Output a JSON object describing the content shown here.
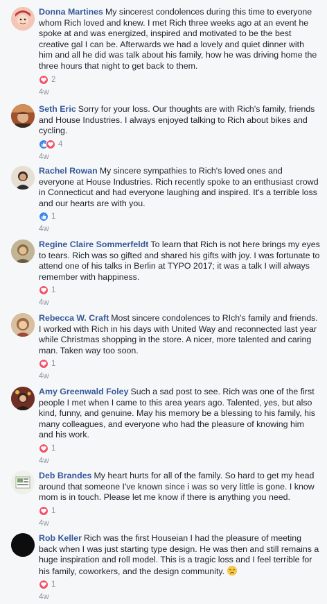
{
  "comments": [
    {
      "author": "Donna Martines",
      "text": "My sincerest condolences during this time to everyone whom Rich loved and knew. I met Rich three weeks ago at an event he spoke at and was energized, inspired and motivated to be the best creative gal I can be. Afterwards we had a lovely and quiet dinner with him and all he did was talk about his family, how he was driving home the three hours that night to get back to them.",
      "reactions": [
        "love"
      ],
      "reaction_count": "2",
      "time": "4w"
    },
    {
      "author": "Seth Eric",
      "text": "Sorry for your loss. Our thoughts are with Rich's family, friends and House Industries. I always enjoyed talking to Rich about bikes and cycling.",
      "reactions": [
        "like",
        "love"
      ],
      "reaction_count": "4",
      "time": "4w"
    },
    {
      "author": "Rachel Rowan",
      "text": "My sincere sympathies to Rich's loved ones and everyone at House Industries. Rich recently spoke to an enthusiast crowd in Connecticut and had everyone laughing and inspired. It's a terrible loss and our hearts are with you.",
      "reactions": [
        "like"
      ],
      "reaction_count": "1",
      "time": "4w"
    },
    {
      "author": "Regine Claire Sommerfeldt",
      "text": "To learn that Rich is not here brings my eyes to tears. Rich was so gifted and shared his gifts with joy. I was fortunate to attend one of his talks in Berlin at TYPO 2017; it was a talk I will always remember with happiness.",
      "reactions": [
        "love"
      ],
      "reaction_count": "1",
      "time": "4w"
    },
    {
      "author": "Rebecca W. Craft",
      "text": "Most sincere condolences to RIch's family and friends. I worked with Rich in his days with United Way and reconnected last year while Christmas shopping in the store. A nicer, more talented and caring man. Taken way too soon.",
      "reactions": [
        "love"
      ],
      "reaction_count": "1",
      "time": "4w"
    },
    {
      "author": "Amy Greenwald Foley",
      "text": "Such a sad post to see. Rich was one of the first people I met when I came to this area years ago. Talented, yes, but also kind, funny, and genuine. May his memory be a blessing to his family, his many colleagues, and everyone who had the pleasure of knowing him and his work.",
      "reactions": [
        "love"
      ],
      "reaction_count": "1",
      "time": "4w"
    },
    {
      "author": "Deb Brandes",
      "text": "My heart hurts for all of the family. So hard to get my head around that someone I've known since i was so very little is gone. I know mom is in touch. Please let me know if there is anything you need.",
      "reactions": [
        "love"
      ],
      "reaction_count": "1",
      "time": "4w"
    },
    {
      "author": "Rob Keller",
      "text": "Rich was the first Houseian I had the pleasure of meeting back when I was just starting type design. He was then and still remains a huge inspiration and roll model. This is a tragic loss and I feel terrible for his family, coworkers, and the design community.",
      "emoji": "disappointed-face",
      "reactions": [
        "love"
      ],
      "reaction_count": "1",
      "time": "4w"
    }
  ],
  "colors": {
    "author": "#365899",
    "love": "#f25268",
    "like": "#3b87ea",
    "meta": "#90949c",
    "background": "#f6f7f9"
  }
}
